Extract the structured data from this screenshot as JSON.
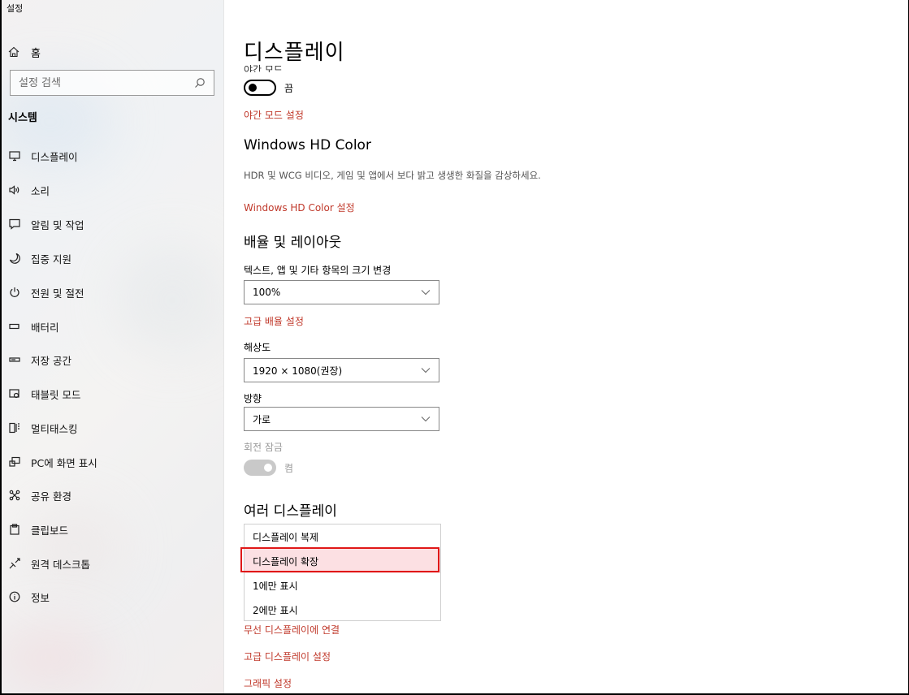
{
  "app": {
    "title": "설정"
  },
  "sidebar": {
    "home_label": "홈",
    "search_placeholder": "설정 검색",
    "section_title": "시스템",
    "items": [
      {
        "label": "디스플레이",
        "icon": "monitor-icon"
      },
      {
        "label": "소리",
        "icon": "speaker-icon"
      },
      {
        "label": "알림 및 작업",
        "icon": "notification-icon"
      },
      {
        "label": "집중 지원",
        "icon": "moon-icon"
      },
      {
        "label": "전원 및 절전",
        "icon": "power-icon"
      },
      {
        "label": "배터리",
        "icon": "battery-icon"
      },
      {
        "label": "저장 공간",
        "icon": "storage-icon"
      },
      {
        "label": "태블릿 모드",
        "icon": "tablet-icon"
      },
      {
        "label": "멀티태스킹",
        "icon": "multitasking-icon"
      },
      {
        "label": "PC에 화면 표시",
        "icon": "project-icon"
      },
      {
        "label": "공유 환경",
        "icon": "shared-icon"
      },
      {
        "label": "클립보드",
        "icon": "clipboard-icon"
      },
      {
        "label": "원격 데스크톱",
        "icon": "remote-icon"
      },
      {
        "label": "정보",
        "icon": "info-icon"
      }
    ]
  },
  "main": {
    "title": "디스플레이",
    "night_mode": {
      "label": "야간 모드",
      "state": "끔",
      "settings_link": "야간 모드 설정"
    },
    "hd_color": {
      "heading": "Windows HD Color",
      "description": "HDR 및 WCG 비디오, 게임 및 앱에서 보다 밝고 생생한 화질을 감상하세요.",
      "link": "Windows HD Color 설정"
    },
    "scale_layout": {
      "heading": "배율 및 레이아웃",
      "scale_label": "텍스트, 앱 및 기타 항목의 크기 변경",
      "scale_value": "100%",
      "advanced_link": "고급 배율 설정",
      "resolution_label": "해상도",
      "resolution_value": "1920 × 1080(권장)",
      "orientation_label": "방향",
      "orientation_value": "가로",
      "rotation_lock_label": "회전 잠금",
      "rotation_lock_state": "켬"
    },
    "multi_display": {
      "heading": "여러 디스플레이",
      "options": [
        "디스플레이 복제",
        "디스플레이 확장",
        "1에만 표시",
        "2에만 표시"
      ],
      "selected": "디스플레이 확장",
      "wireless_link": "무선 디스플레이에 연결",
      "advanced_link": "고급 디스플레이 설정",
      "graphics_link": "그래픽 설정"
    }
  },
  "colors": {
    "accent_link": "#c0392b",
    "highlight_border": "#e01818",
    "selected_bg": "#fce0e3"
  }
}
